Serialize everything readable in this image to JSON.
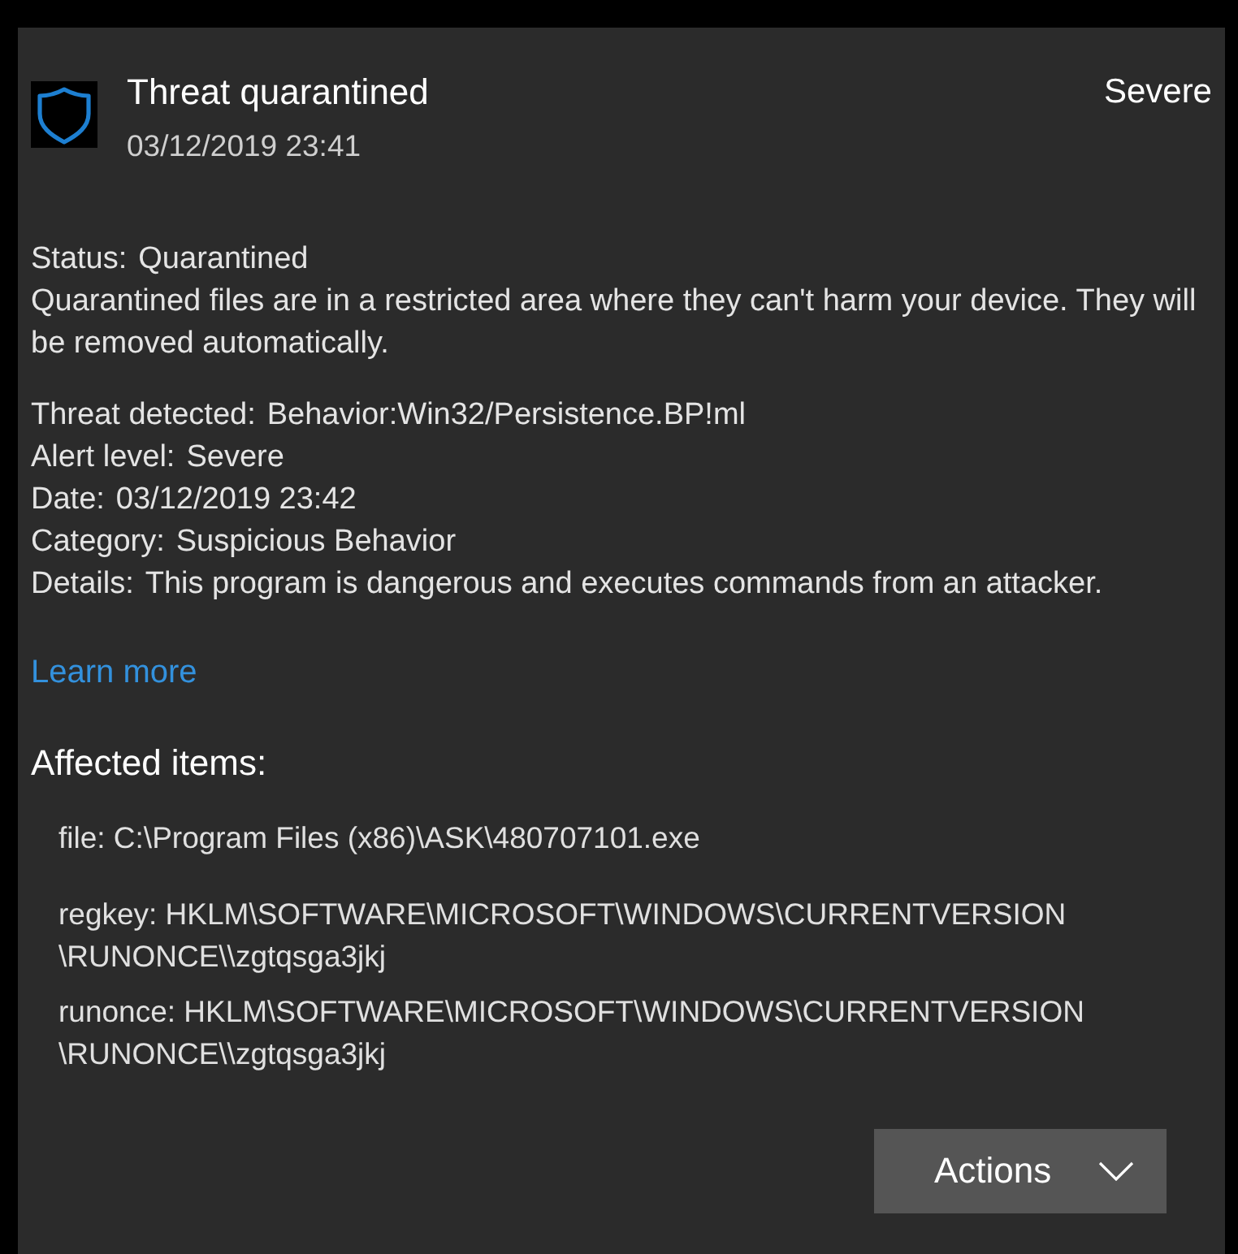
{
  "notification": {
    "title": "Threat quarantined",
    "timestamp": "03/12/2019 23:41",
    "severity": "Severe"
  },
  "status": {
    "label": "Status:",
    "value": "Quarantined",
    "description": "Quarantined files are in a restricted area where they can't harm your device. They will be removed automatically."
  },
  "details": [
    {
      "label": "Threat detected:",
      "value": "Behavior:Win32/Persistence.BP!ml"
    },
    {
      "label": "Alert level:",
      "value": "Severe"
    },
    {
      "label": "Date:",
      "value": "03/12/2019 23:42"
    },
    {
      "label": "Category:",
      "value": "Suspicious Behavior"
    },
    {
      "label": "Details:",
      "value": "This program is dangerous and executes commands from an attacker."
    }
  ],
  "learn_more": "Learn more",
  "affected_items": {
    "heading": "Affected items:",
    "items": [
      "file: C:\\Program Files (x86)\\ASK\\480707101.exe",
      "regkey: HKLM\\SOFTWARE\\MICROSOFT\\WINDOWS\\CURRENTVERSION \\RUNONCE\\\\zgtqsga3jkj",
      "runonce: HKLM\\SOFTWARE\\MICROSOFT\\WINDOWS\\CURRENTVERSION \\RUNONCE\\\\zgtqsga3jkj"
    ]
  },
  "actions_button": {
    "label": "Actions"
  }
}
